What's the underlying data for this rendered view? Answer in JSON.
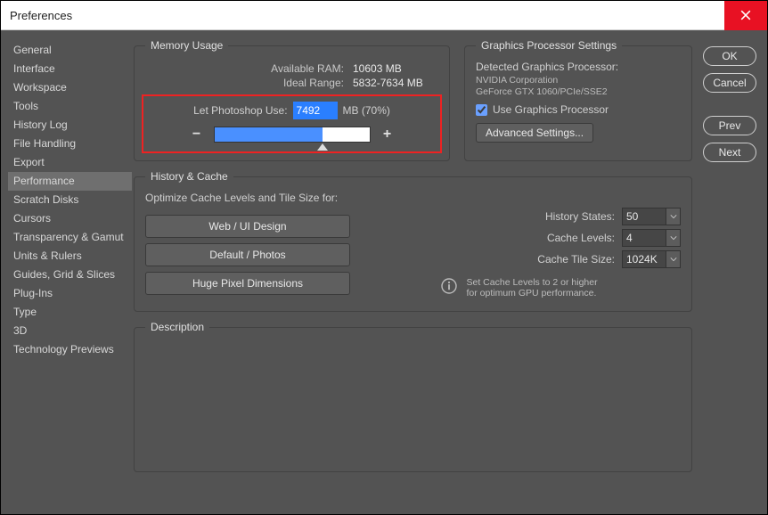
{
  "window": {
    "title": "Preferences"
  },
  "sidebar": {
    "items": [
      "General",
      "Interface",
      "Workspace",
      "Tools",
      "History Log",
      "File Handling",
      "Export",
      "Performance",
      "Scratch Disks",
      "Cursors",
      "Transparency & Gamut",
      "Units & Rulers",
      "Guides, Grid & Slices",
      "Plug-Ins",
      "Type",
      "3D",
      "Technology Previews"
    ],
    "activeIndex": 7
  },
  "memory": {
    "legend": "Memory Usage",
    "available_label": "Available RAM:",
    "available_value": "10603 MB",
    "ideal_label": "Ideal Range:",
    "ideal_value": "5832-7634 MB",
    "let_label": "Let Photoshop Use:",
    "let_value": "7492",
    "let_suffix": "MB (70%)",
    "slider_percent": 70
  },
  "gpu": {
    "legend": "Graphics Processor Settings",
    "detected_label": "Detected Graphics Processor:",
    "vendor": "NVIDIA Corporation",
    "device": "GeForce GTX 1060/PCIe/SSE2",
    "use_label": "Use Graphics Processor",
    "use_checked": true,
    "adv_button": "Advanced Settings..."
  },
  "history": {
    "legend": "History & Cache",
    "optimize_label": "Optimize Cache Levels and Tile Size for:",
    "buttons": [
      "Web / UI Design",
      "Default / Photos",
      "Huge Pixel Dimensions"
    ],
    "states_label": "History States:",
    "states_value": "50",
    "levels_label": "Cache Levels:",
    "levels_value": "4",
    "tile_label": "Cache Tile Size:",
    "tile_value": "1024K",
    "info_text": "Set Cache Levels to 2 or higher for optimum GPU performance."
  },
  "description": {
    "legend": "Description"
  },
  "buttons": {
    "ok": "OK",
    "cancel": "Cancel",
    "prev": "Prev",
    "next": "Next"
  }
}
